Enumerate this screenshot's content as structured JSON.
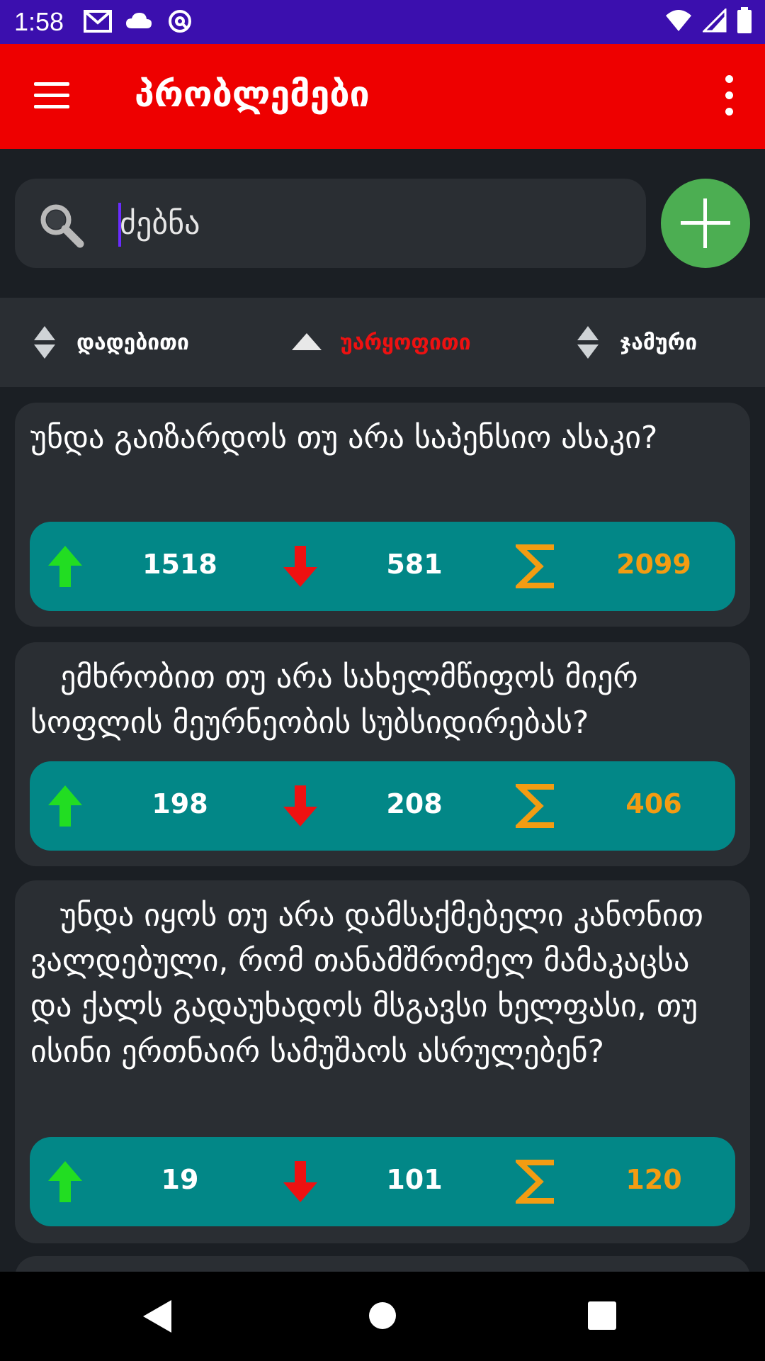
{
  "status_bar": {
    "time": "1:58"
  },
  "app_bar": {
    "title": "პრობლემები"
  },
  "search": {
    "value": "ძებნა"
  },
  "sort": {
    "items": [
      {
        "label": "დადებითი",
        "state": "neutral"
      },
      {
        "label": "უარყოფითი",
        "state": "active"
      },
      {
        "label": "ჯამური",
        "state": "neutral"
      }
    ]
  },
  "cards": [
    {
      "text": "უნდა გაიზარდოს თუ არა საპენსიო ასაკი?",
      "up": "1518",
      "down": "581",
      "total": "2099"
    },
    {
      "text": "   ემხრობით თუ არა სახელმწიფოს მიერ სოფლის მეურნეობის სუბსიდირებას?",
      "up": "198",
      "down": "208",
      "total": "406"
    },
    {
      "text": "   უნდა იყოს თუ არა დამსაქმებელი კანონით ვალდებული, რომ თანამშრომელ მამაკაცსა და ქალს გადაუხადოს მსგავსი ხელფასი, თუ ისინი ერთნაირ სამუშაოს ასრულებენ?",
      "up": "19",
      "down": "101",
      "total": "120"
    }
  ],
  "colors": {
    "status_bar": "#3b0fae",
    "app_bar": "#ee0000",
    "stats_bg": "#028787",
    "up_arrow": "#22dd22",
    "down_arrow": "#ee1111",
    "sum_icon": "#f39c12",
    "add_button": "#4cae52"
  }
}
